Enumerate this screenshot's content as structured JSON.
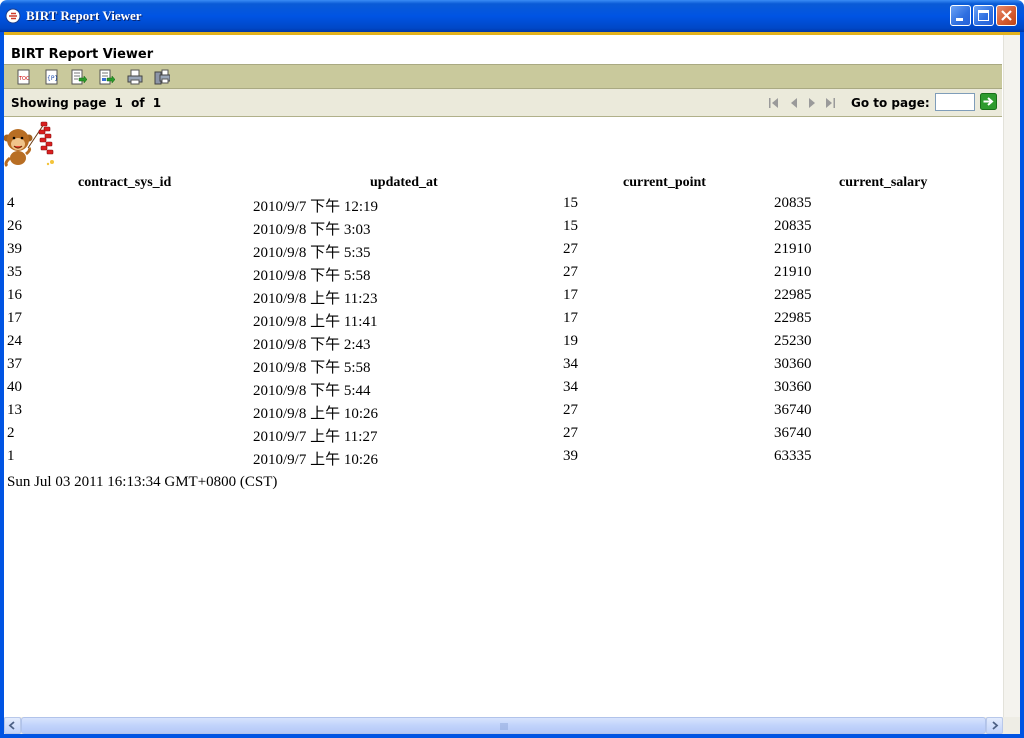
{
  "window": {
    "title": "BIRT Report Viewer",
    "icon": "birt-app-icon",
    "controls": [
      "minimize-icon",
      "maximize-icon",
      "close-icon"
    ]
  },
  "viewer": {
    "title": "BIRT Report Viewer"
  },
  "toolbar": {
    "icons": [
      "toc-icon",
      "parameter-icon",
      "export-data-icon",
      "export-report-icon",
      "print-icon",
      "print-server-icon"
    ]
  },
  "navigation": {
    "showing_label": "Showing page",
    "current_page": "1",
    "of_label": "of",
    "total_pages": "1",
    "goto_label": "Go to page:",
    "goto_value": "",
    "arrows": [
      "first-page-icon",
      "previous-page-icon",
      "next-page-icon",
      "last-page-icon"
    ],
    "go_icon": "go-arrow-icon"
  },
  "report": {
    "logo": "monkey-firecracker-logo",
    "columns": [
      "contract_sys_id",
      "updated_at",
      "current_point",
      "current_salary"
    ],
    "rows": [
      [
        "4",
        "2010/9/7 下午 12:19",
        "15",
        "20835"
      ],
      [
        "26",
        "2010/9/8 下午 3:03",
        "15",
        "20835"
      ],
      [
        "39",
        "2010/9/8 下午 5:35",
        "27",
        "21910"
      ],
      [
        "35",
        "2010/9/8 下午 5:58",
        "27",
        "21910"
      ],
      [
        "16",
        "2010/9/8 上午 11:23",
        "17",
        "22985"
      ],
      [
        "17",
        "2010/9/8 上午 11:41",
        "17",
        "22985"
      ],
      [
        "24",
        "2010/9/8 下午 2:43",
        "19",
        "25230"
      ],
      [
        "37",
        "2010/9/8 下午 5:58",
        "34",
        "30360"
      ],
      [
        "40",
        "2010/9/8 下午 5:44",
        "34",
        "30360"
      ],
      [
        "13",
        "2010/9/8 上午 10:26",
        "27",
        "36740"
      ],
      [
        "2",
        "2010/9/7 上午 11:27",
        "27",
        "36740"
      ],
      [
        "1",
        "2010/9/7 上午 10:26",
        "39",
        "63335"
      ]
    ],
    "generated_at": "Sun Jul 03 2011 16:13:34 GMT+0800 (CST)"
  },
  "colors": {
    "titlebar_blue": "#0054e3",
    "accent_gold": "#e2b11d",
    "toolbar_olive": "#c9c99c",
    "navbar_beige": "#ebeadb"
  }
}
